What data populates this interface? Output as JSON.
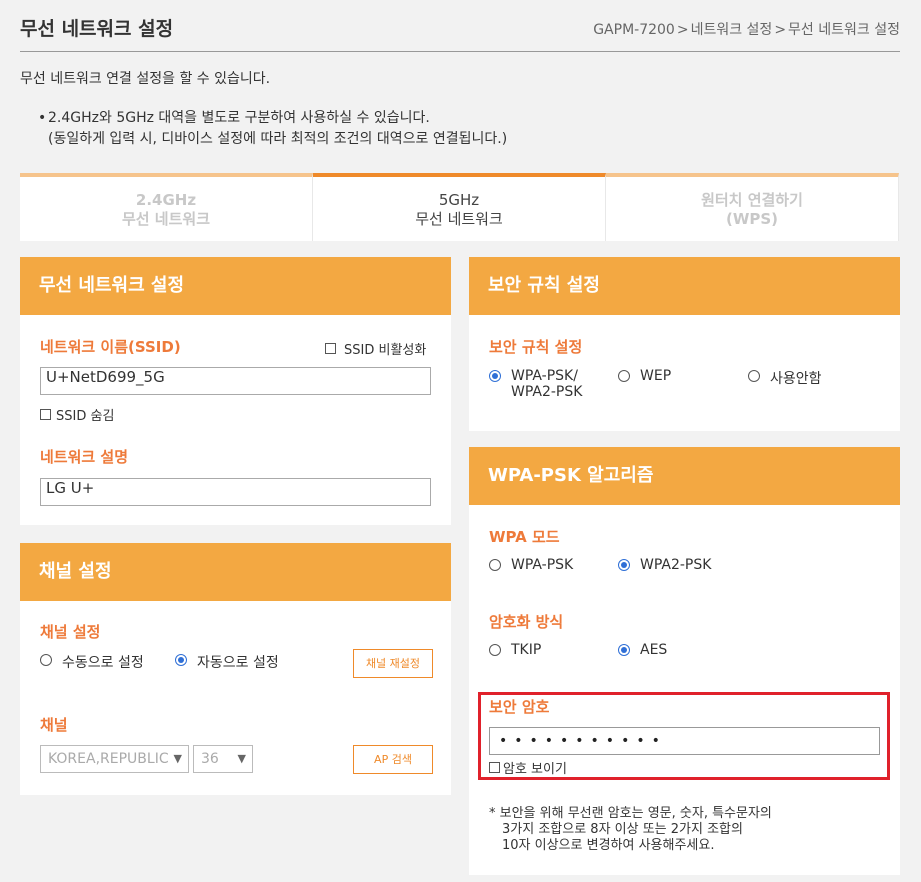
{
  "header": {
    "title": "무선 네트워크 설정",
    "breadcrumb": [
      "GAPM-7200",
      "네트워크 설정",
      "무선 네트워크 설정"
    ],
    "breadcrumb_sep": ">"
  },
  "description": "무선 네트워크 연결 설정을 할 수 있습니다.",
  "note": {
    "bullet": "•",
    "line1": "2.4GHz와 5GHz 대역을 별도로 구분하여 사용하실 수 있습니다.",
    "line2": "(동일하게 입력 시, 디바이스 설정에 따라 최적의 조건의 대역으로 연결됩니다.)"
  },
  "tabs": [
    {
      "line1": "2.4GHz",
      "line2": "무선 네트워크",
      "active": false
    },
    {
      "line1": "5GHz",
      "line2": "무선 네트워크",
      "active": true
    },
    {
      "line1": "원터치 연결하기",
      "line2": "(WPS)",
      "active": false
    }
  ],
  "wireless": {
    "title": "무선 네트워크 설정",
    "ssid_label": "네트워크 이름(SSID)",
    "ssid_disable_label": "SSID 비활성화",
    "ssid_value": "U+NetD699_5G",
    "ssid_hide_label": "SSID 숨김",
    "desc_label": "네트워크 설명",
    "desc_value": "LG U+"
  },
  "channel": {
    "title": "채널 설정",
    "setting_label": "채널 설정",
    "manual_label": "수동으로 설정",
    "auto_label": "자동으로 설정",
    "reset_button": "채널 재설정",
    "channel_label": "채널",
    "country_value": "KOREA,REPUBLIC",
    "channel_value": "36",
    "ap_search_button": "AP 검색"
  },
  "security": {
    "title": "보안 규칙 설정",
    "rule_label": "보안 규칙 설정",
    "opt_wpa_line1": "WPA-PSK/",
    "opt_wpa_line2": "WPA2-PSK",
    "opt_wep": "WEP",
    "opt_none": "사용안함"
  },
  "wpa": {
    "title": "WPA-PSK 알고리즘",
    "mode_label": "WPA 모드",
    "mode_wpa": "WPA-PSK",
    "mode_wpa2": "WPA2-PSK",
    "enc_label": "암호화 방식",
    "enc_tkip": "TKIP",
    "enc_aes": "AES",
    "pw_label": "보안 암호",
    "pw_value": "•••••••••••",
    "show_pw_label": "암호 보이기",
    "footnote1": "* 보안을 위해 무선랜 암호는 영문, 숫자, 특수문자의",
    "footnote2": "3가지 조합으로 8자 이상 또는 2가지 조합의",
    "footnote3": "10자 이상으로 변경하여 사용해주세요."
  },
  "colors": {
    "accent": "#f3a842",
    "label": "#ee7a3a",
    "highlight": "#e0212b",
    "radio_selected": "#2f6fd6"
  }
}
